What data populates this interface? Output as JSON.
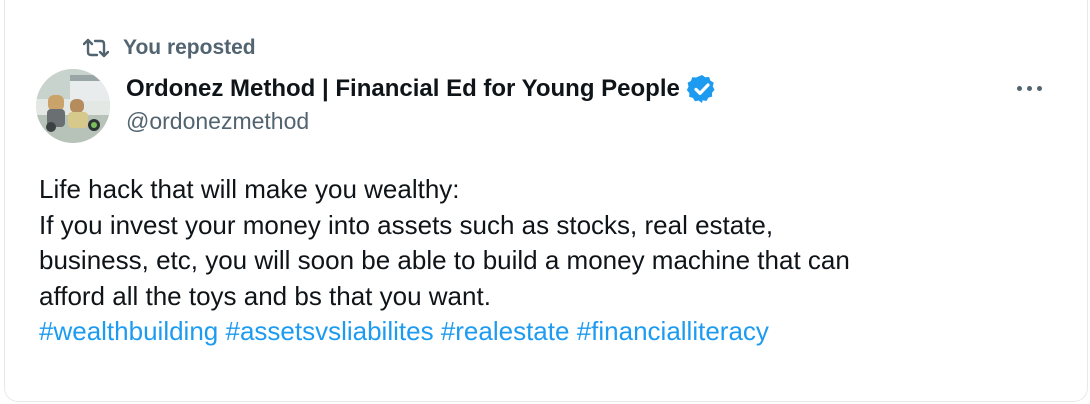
{
  "repost": {
    "label": "You reposted",
    "icon": "repost-icon"
  },
  "author": {
    "display_name": "Ordonez Method | Financial Ed for Young People",
    "handle": "@ordonezmethod",
    "verified_icon": "verified-badge-icon",
    "avatar_icon": "avatar-image"
  },
  "more_icon": "more-options-icon",
  "post": {
    "lines": [
      "Life hack that will make you wealthy:",
      "If you invest your money into assets such as stocks, real estate,",
      "business, etc, you will soon be able to build a money machine that can",
      "afford all the toys and bs that you want."
    ],
    "hashtags": [
      "#wealthbuilding",
      "#assetsvsliabilites",
      "#realestate",
      "#financialliteracy"
    ]
  },
  "colors": {
    "link": "#1d9bf0",
    "muted": "#536471",
    "text": "#0f1419"
  }
}
